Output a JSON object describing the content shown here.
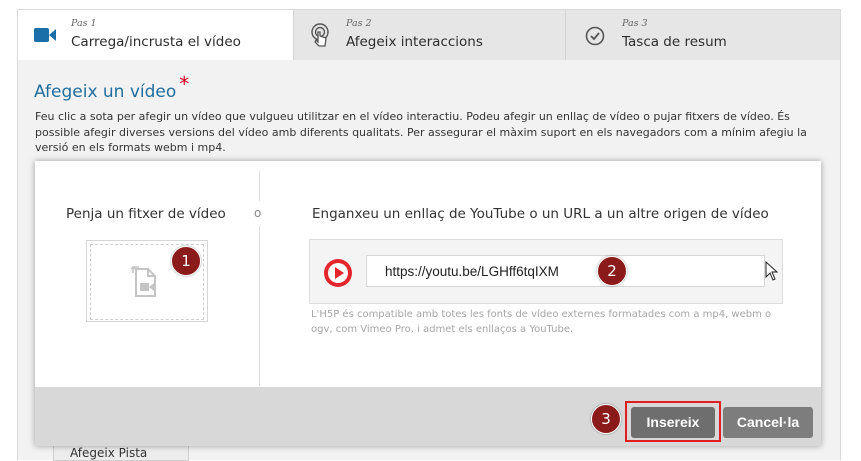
{
  "tabs": [
    {
      "step": "Pas 1",
      "title": "Carrega/incrusta el vídeo",
      "icon": "video-camera-icon",
      "active": true
    },
    {
      "step": "Pas 2",
      "title": "Afegeix interaccions",
      "icon": "touch-icon",
      "active": false
    },
    {
      "step": "Pas 3",
      "title": "Tasca de resum",
      "icon": "checkmark-circle-icon",
      "active": false
    }
  ],
  "section": {
    "heading": "Afegeix un vídeo",
    "required_mark": "*",
    "description": "Feu clic a sota per afegir un vídeo que vulgueu utilitzar en el vídeo interactiu. Podeu afegir un enllaç de vídeo o pujar fitxers de vídeo. És possible afegir diverses versions del vídeo amb diferents qualitats. Per assegurar el màxim suport en els navegadors com a mínim afegiu la versió en els formats webm i mp4."
  },
  "dialog": {
    "upload_title": "Penja un fitxer de vídeo",
    "or_label": "o",
    "link_title": "Enganxeu un enllaç de YouTube o un URL a un altre origen de vídeo",
    "url_value": "https://youtu.be/LGHff6tqIXM",
    "note": "L'H5P és compatible amb totes les fonts de vídeo externes formatades com a mp4, webm o ogv, com Vimeo Pro, i admet els enllaços a YouTube.",
    "insert_label": "Insereix",
    "cancel_label": "Cancel·la"
  },
  "badges": [
    "1",
    "2",
    "3"
  ],
  "below_button": "Afegeix Pista",
  "colors": {
    "accent": "#1f6e9e",
    "required": "#d0021b",
    "youtube": "#e3262b",
    "badge": "#8b1a1a",
    "highlight": "#e01e1e"
  }
}
